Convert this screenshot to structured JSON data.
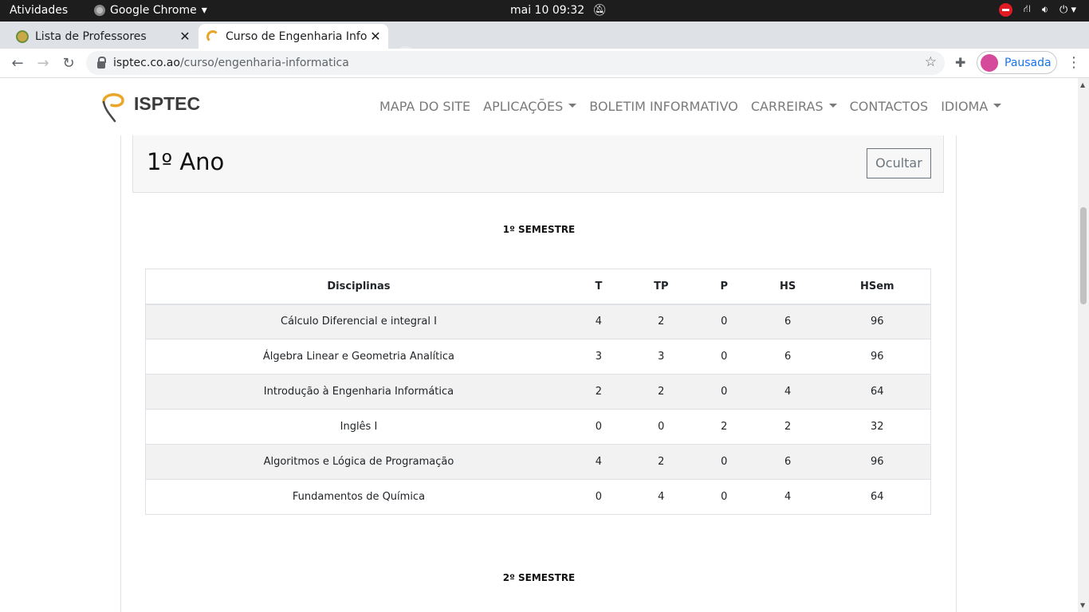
{
  "system_bar": {
    "activities": "Atividades",
    "app_name": "Google Chrome",
    "clock": "mai 10  09:32"
  },
  "browser": {
    "tabs": [
      {
        "title": "Lista de Professores"
      },
      {
        "title": "Curso de Engenharia Info"
      }
    ],
    "url_host": "isptec.co.ao",
    "url_path": "/curso/engenharia-informatica",
    "profile_label": "Pausada"
  },
  "site": {
    "logo_text": "ISPTEC",
    "nav": [
      {
        "label": "MAPA DO SITE",
        "dropdown": false
      },
      {
        "label": "APLICAÇÕES",
        "dropdown": true
      },
      {
        "label": "BOLETIM INFORMATIVO",
        "dropdown": false
      },
      {
        "label": "CARREIRAS",
        "dropdown": true
      },
      {
        "label": "CONTACTOS",
        "dropdown": false
      },
      {
        "label": "IDIOMA",
        "dropdown": true
      }
    ]
  },
  "year_card": {
    "title": "1º Ano",
    "toggle_label": "Ocultar"
  },
  "semesters": [
    {
      "label": "1º SEMESTRE",
      "columns": [
        "Disciplinas",
        "T",
        "TP",
        "P",
        "HS",
        "HSem"
      ],
      "rows": [
        [
          "Cálculo Diferencial e integral I",
          "4",
          "2",
          "0",
          "6",
          "96"
        ],
        [
          "Álgebra Linear e Geometria Analítica",
          "3",
          "3",
          "0",
          "6",
          "96"
        ],
        [
          "Introdução à Engenharia Informática",
          "2",
          "2",
          "0",
          "4",
          "64"
        ],
        [
          "Inglês I",
          "0",
          "0",
          "2",
          "2",
          "32"
        ],
        [
          "Algoritmos e Lógica de Programação",
          "4",
          "2",
          "0",
          "6",
          "96"
        ],
        [
          "Fundamentos de Química",
          "0",
          "4",
          "0",
          "4",
          "64"
        ]
      ]
    },
    {
      "label": "2º SEMESTRE"
    }
  ]
}
